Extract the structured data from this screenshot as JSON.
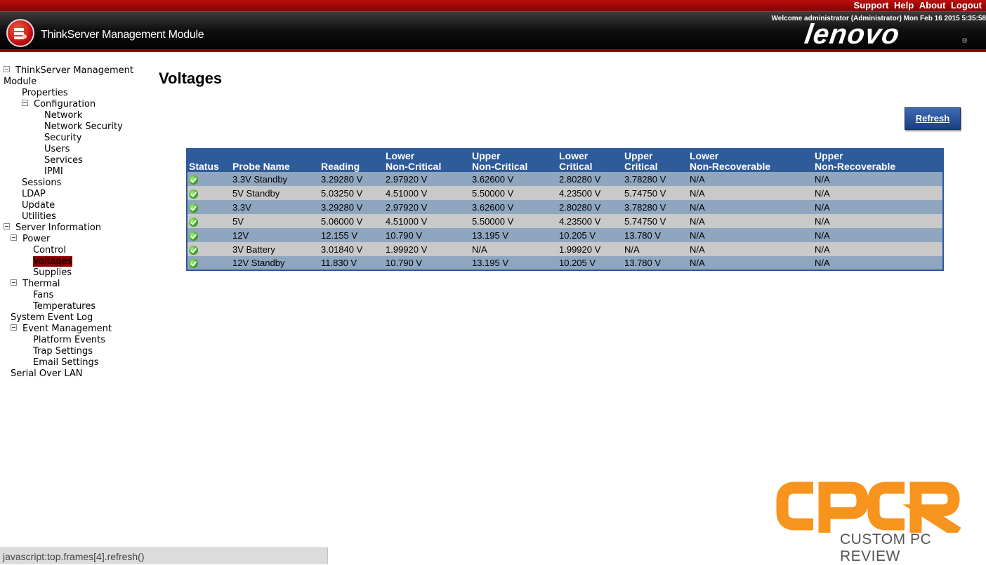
{
  "topbar": {
    "links": [
      "Support",
      "Help",
      "About",
      "Logout"
    ]
  },
  "header": {
    "product_title": "ThinkServer Management Module",
    "welcome": "Welcome administrator (Administrator) Mon Feb 16 2015 5:35:58",
    "brand": "lenovo",
    "brand_mark": "®"
  },
  "sidebar": {
    "nodes": [
      {
        "label": "ThinkServer Management",
        "toggle": true
      },
      {
        "label": "Module",
        "toggle": false
      },
      {
        "label": "Properties",
        "toggle": false
      },
      {
        "label": "Configuration",
        "toggle": true
      },
      {
        "label": "Network",
        "toggle": false
      },
      {
        "label": "Network Security",
        "toggle": false
      },
      {
        "label": "Security",
        "toggle": false
      },
      {
        "label": "Users",
        "toggle": false
      },
      {
        "label": "Services",
        "toggle": false
      },
      {
        "label": "IPMI",
        "toggle": false
      },
      {
        "label": "Sessions",
        "toggle": false
      },
      {
        "label": "LDAP",
        "toggle": false
      },
      {
        "label": "Update",
        "toggle": false
      },
      {
        "label": "Utilities",
        "toggle": false
      },
      {
        "label": "Server Information",
        "toggle": true
      },
      {
        "label": "Power",
        "toggle": true
      },
      {
        "label": "Control",
        "toggle": false
      },
      {
        "label": "Voltages",
        "toggle": false,
        "selected": true
      },
      {
        "label": "Supplies",
        "toggle": false
      },
      {
        "label": "Thermal",
        "toggle": true
      },
      {
        "label": "Fans",
        "toggle": false
      },
      {
        "label": "Temperatures",
        "toggle": false
      },
      {
        "label": "System Event Log",
        "toggle": false
      },
      {
        "label": "Event Management",
        "toggle": true
      },
      {
        "label": "Platform Events",
        "toggle": false
      },
      {
        "label": "Trap Settings",
        "toggle": false
      },
      {
        "label": "Email Settings",
        "toggle": false
      },
      {
        "label": "Serial Over LAN",
        "toggle": false
      }
    ]
  },
  "main": {
    "title": "Voltages",
    "refresh_label": "Refresh",
    "columns": [
      [
        "",
        "Status"
      ],
      [
        "",
        "Probe Name"
      ],
      [
        "",
        "Reading"
      ],
      [
        "Lower",
        "Non-Critical"
      ],
      [
        "Upper",
        "Non-Critical"
      ],
      [
        "Lower",
        "Critical"
      ],
      [
        "Upper",
        "Critical"
      ],
      [
        "Lower",
        "Non-Recoverable"
      ],
      [
        "Upper",
        "Non-Recoverable"
      ]
    ],
    "rows": [
      {
        "status": "ok",
        "probe": "3.3V Standby",
        "reading": "3.29280 V",
        "lnc": "2.97920 V",
        "unc": "3.62600 V",
        "lc": "2.80280 V",
        "uc": "3.78280 V",
        "lnr": "N/A",
        "unr": "N/A"
      },
      {
        "status": "ok",
        "probe": "5V Standby",
        "reading": "5.03250 V",
        "lnc": "4.51000 V",
        "unc": "5.50000 V",
        "lc": "4.23500 V",
        "uc": "5.74750 V",
        "lnr": "N/A",
        "unr": "N/A"
      },
      {
        "status": "ok",
        "probe": "3.3V",
        "reading": "3.29280 V",
        "lnc": "2.97920 V",
        "unc": "3.62600 V",
        "lc": "2.80280 V",
        "uc": "3.78280 V",
        "lnr": "N/A",
        "unr": "N/A"
      },
      {
        "status": "ok",
        "probe": "5V",
        "reading": "5.06000 V",
        "lnc": "4.51000 V",
        "unc": "5.50000 V",
        "lc": "4.23500 V",
        "uc": "5.74750 V",
        "lnr": "N/A",
        "unr": "N/A"
      },
      {
        "status": "ok",
        "probe": "12V",
        "reading": "12.155 V",
        "lnc": "10.790 V",
        "unc": "13.195 V",
        "lc": "10.205 V",
        "uc": "13.780 V",
        "lnr": "N/A",
        "unr": "N/A"
      },
      {
        "status": "ok",
        "probe": "3V Battery",
        "reading": "3.01840 V",
        "lnc": "1.99920 V",
        "unc": "N/A",
        "lc": "1.99920 V",
        "uc": "N/A",
        "lnr": "N/A",
        "unr": "N/A"
      },
      {
        "status": "ok",
        "probe": "12V Standby",
        "reading": "11.830 V",
        "lnc": "10.790 V",
        "unc": "13.195 V",
        "lc": "10.205 V",
        "uc": "13.780 V",
        "lnr": "N/A",
        "unr": "N/A"
      }
    ]
  },
  "watermark": {
    "logo_text": "CPCR",
    "subtitle": "CUSTOM PC REVIEW",
    "color": "#f7941d"
  },
  "statusbar": {
    "text": "javascript:top.frames[4].refresh()"
  },
  "colors": {
    "header_red": "#a00000",
    "table_header": "#2e5b9a",
    "row_odd": "#8fa6bf",
    "row_even": "#c9c9c9",
    "selected": "#8b0000"
  }
}
